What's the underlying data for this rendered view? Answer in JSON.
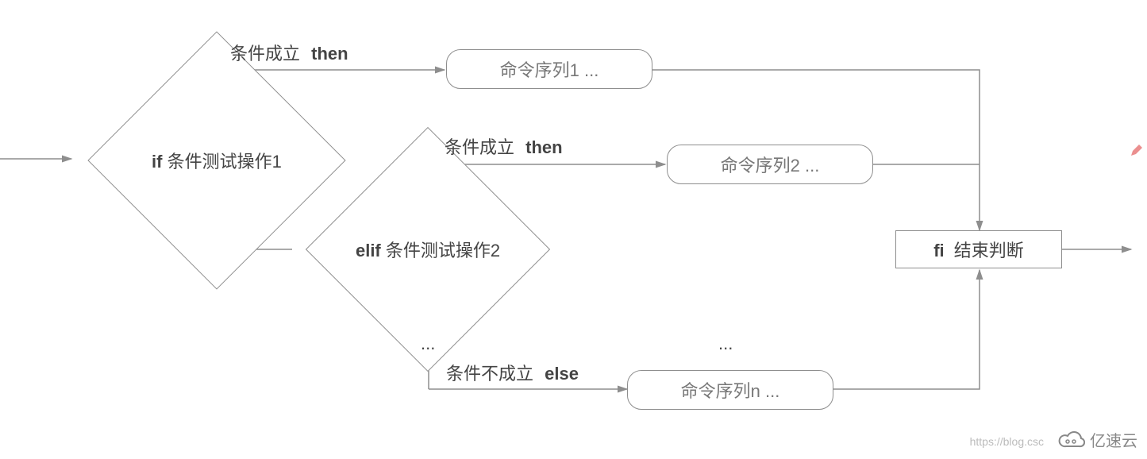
{
  "diamond1": {
    "kw": "if",
    "text": "条件测试操作1"
  },
  "diamond2": {
    "kw": "elif",
    "text": "条件测试操作2"
  },
  "label_true1": {
    "text": "条件成立",
    "kw": "then"
  },
  "label_true2": {
    "text": "条件成立",
    "kw": "then"
  },
  "label_else": {
    "text": "条件不成立",
    "kw": "else"
  },
  "seq1": "命令序列1 ...",
  "seq2": "命令序列2 ...",
  "seqn": "命令序列n ...",
  "fi": {
    "kw": "fi",
    "text": "结束判断"
  },
  "ellipsis1": "...",
  "ellipsis2": "...",
  "watermark_url": "https://blog.csc",
  "brand": "亿速云"
}
